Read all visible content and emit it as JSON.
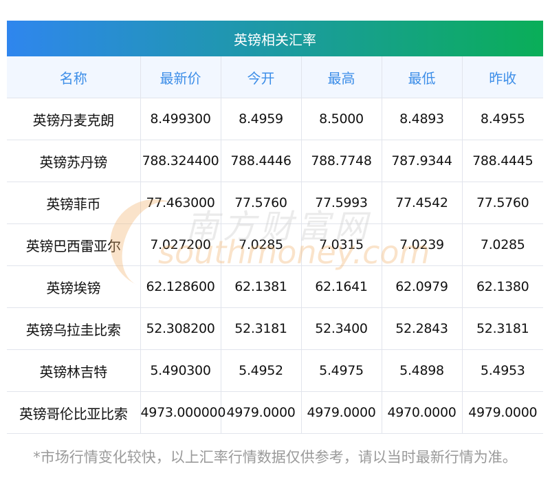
{
  "title": "英镑相关汇率",
  "columns": [
    "名称",
    "最新价",
    "今开",
    "最高",
    "最低",
    "昨收"
  ],
  "rows": [
    [
      "英镑丹麦克朗",
      "8.499300",
      "8.4959",
      "8.5000",
      "8.4893",
      "8.4955"
    ],
    [
      "英镑苏丹镑",
      "788.324400",
      "788.4446",
      "788.7748",
      "787.9344",
      "788.4445"
    ],
    [
      "英镑菲币",
      "77.463000",
      "77.5760",
      "77.5993",
      "77.4542",
      "77.5760"
    ],
    [
      "英镑巴西雷亚尔",
      "7.027200",
      "7.0285",
      "7.0315",
      "7.0239",
      "7.0285"
    ],
    [
      "英镑埃镑",
      "62.128600",
      "62.1381",
      "62.1641",
      "62.0979",
      "62.1380"
    ],
    [
      "英镑乌拉圭比索",
      "52.308200",
      "52.3181",
      "52.3400",
      "52.2843",
      "52.3181"
    ],
    [
      "英镑林吉特",
      "5.490300",
      "5.4952",
      "5.4975",
      "5.4898",
      "5.4953"
    ],
    [
      "英镑哥伦比亚比索",
      "4973.000000",
      "4979.0000",
      "4979.0000",
      "4970.0000",
      "4979.0000"
    ]
  ],
  "note": "*市场行情变化较快，以上汇率行情数据仅供参考，请以当时最新行情为准。",
  "watermark": {
    "cn": "南方财富网",
    "en": "southmoney.com"
  }
}
